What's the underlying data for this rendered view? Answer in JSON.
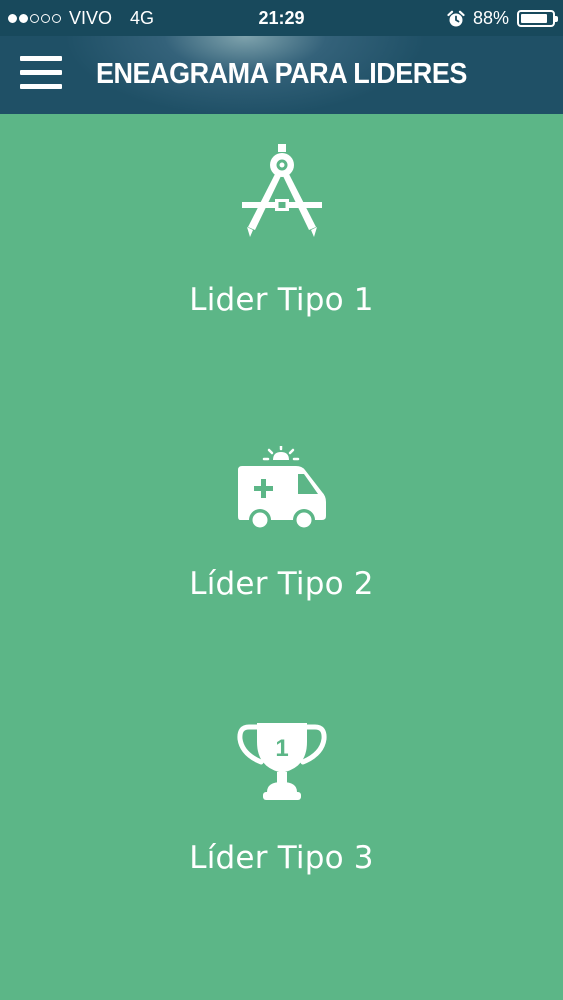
{
  "status_bar": {
    "signal_dots": "●●○○○",
    "carrier": "VIVO",
    "network": "4G",
    "time": "21:29",
    "alarm_icon": "alarm-clock-icon",
    "battery_percent": "88%",
    "battery_level": 0.88
  },
  "nav": {
    "menu_icon": "hamburger-menu-icon",
    "title": "ENEAGRAMA PARA LIDERES"
  },
  "leaders": [
    {
      "label": "Lider Tipo 1",
      "icon": "drafting-compass-icon"
    },
    {
      "label": "Líder Tipo 2",
      "icon": "ambulance-icon"
    },
    {
      "label": "Líder Tipo 3",
      "icon": "trophy-icon",
      "icon_text": "1"
    }
  ],
  "colors": {
    "background": "#5cb687",
    "status_bar": "#18495c",
    "nav_bar": "#1f5066",
    "foreground": "#ffffff"
  }
}
